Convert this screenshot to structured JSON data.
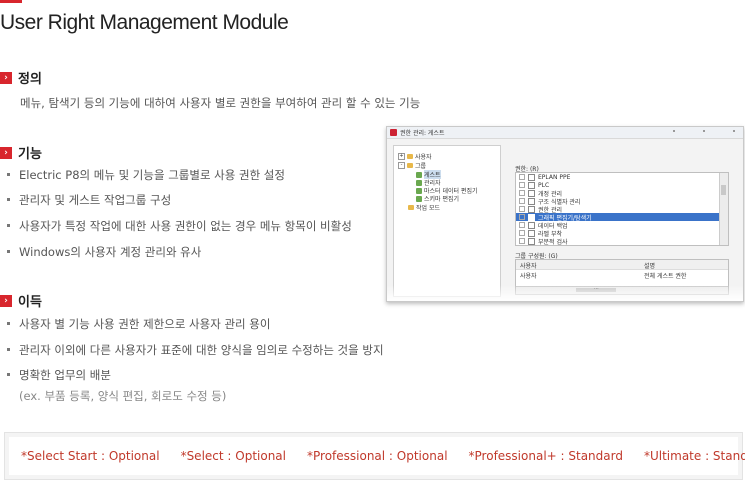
{
  "page": {
    "title": "User Right Management Module"
  },
  "sections": {
    "definition": {
      "title": "정의",
      "text": "메뉴, 탐색기 등의 기능에  대하여 사용자 별로 권한을 부여하여 관리 할 수 있는 기능"
    },
    "feature": {
      "title": "기능",
      "bullets": [
        "Electric P8의 메뉴 및 기능을 그룹별로  사용 권한 설정",
        "관리자 및 게스트 작업그룹 구성",
        "사용자가 특정 작업에 대한 사용 권한이 없는 경우 메뉴 항목이 비활성",
        "Windows의 사용자 계정 관리와 유사"
      ]
    },
    "benefit": {
      "title": "이득",
      "bullets": [
        "사용자 별 기능 사용 권한 제한으로 사용자 관리 용이",
        "관리자 이외에 다른 사용자가 표준에 대한 양식을 임의로 수정하는 것을 방지",
        "명확한 업무의 배분"
      ],
      "sub_note": "(ex. 부품 등록, 양식 편집, 회로도 수정 등)"
    }
  },
  "screenshot": {
    "window_title": "권한 관리: 게스트",
    "tree": [
      {
        "label": "사용자",
        "kind": "folder",
        "expander": "+"
      },
      {
        "label": "그룹",
        "kind": "folder",
        "expander": "-"
      },
      {
        "label": "게스트",
        "kind": "user",
        "selected": true
      },
      {
        "label": "관리자",
        "kind": "user"
      },
      {
        "label": "마스터 데이터 편집기",
        "kind": "user"
      },
      {
        "label": "스키마 편집기",
        "kind": "user"
      },
      {
        "label": "작업 모드",
        "kind": "folder"
      }
    ],
    "permissions_label": "권한: (R)",
    "permissions": [
      {
        "label": "EPLAN PPE"
      },
      {
        "label": "PLC"
      },
      {
        "label": "개정 관리"
      },
      {
        "label": "구조 식별자 관리"
      },
      {
        "label": "권한 관리"
      },
      {
        "label": "그래픽 편집기/탐색기",
        "selected": true,
        "checked": true
      },
      {
        "label": "데이터 백업"
      },
      {
        "label": "라벨 부착"
      },
      {
        "label": "부분적 검사"
      }
    ],
    "group_label": "그룹 구성원: (G)",
    "group_columns": [
      "사용자",
      "설명"
    ],
    "group_row": [
      "사용자",
      "전체 게스트 권한"
    ],
    "scroll_mark": "..."
  },
  "editions": [
    "*Select Start : Optional",
    "*Select : Optional",
    "*Professional : Optional",
    "*Professional+ : Standard",
    "*Ultimate : Standard"
  ],
  "colors": {
    "accent": "#d8262d",
    "edition_text": "#c0392b"
  }
}
